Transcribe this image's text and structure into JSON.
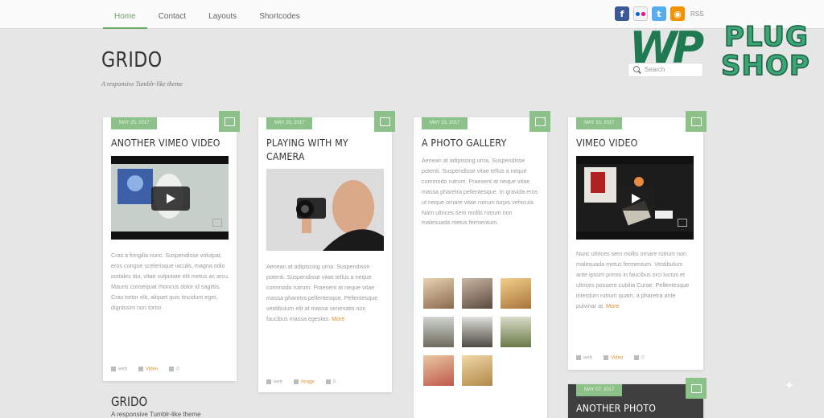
{
  "nav": {
    "items": [
      {
        "label": "Home",
        "active": true
      },
      {
        "label": "Contact",
        "active": false
      },
      {
        "label": "Layouts",
        "active": false
      },
      {
        "label": "Shortcodes",
        "active": false
      }
    ]
  },
  "social": {
    "rss_label": "RSS",
    "icons": [
      "facebook-icon",
      "flickr-icon",
      "twitter-icon",
      "rss-icon"
    ]
  },
  "site": {
    "title": "GRIDO",
    "tagline": "A responsive Tumblr-like theme"
  },
  "search": {
    "placeholder": "Search"
  },
  "watermark": {
    "wp": "WP",
    "plug": "PLUG",
    "shop": "SHOP"
  },
  "posts": [
    {
      "date": "MAY 25, 2017",
      "type_icon": "video-icon",
      "title": "ANOTHER VIMEO VIDEO",
      "excerpt": "Cras a fringilla nunc. Suspendisse volutpat, eros congue scelerisque iaculis, magna odio sodales dui, vitae vulputate elit metus ac arcu. Mauris consequat rhoncus dolor id sagittis. Cras tortor elit, aliquet quis tincidunt eget, dignissim non tortor.",
      "meta": {
        "author": "web",
        "tag": "Video",
        "comments": "0"
      }
    },
    {
      "date": "MAY 20, 2017",
      "type_icon": "image-icon",
      "title": "PLAYING WITH MY CAMERA",
      "excerpt": "Aenean at adipiscing urna. Suspendisse potenti. Suspendisse vitae tellus a neque commodo rutrum. Praesent at neque vitae massa pharetra pellentesque. Pellentesque vestibulum elit at massa venenatis non faucibus massa egestas.",
      "more": "More",
      "meta": {
        "author": "web",
        "tag": "Image",
        "comments": "0"
      }
    },
    {
      "date": "MAY 15, 2017",
      "type_icon": "gallery-icon",
      "title": "A PHOTO GALLERY",
      "excerpt": "Aenean at adipiscing urna. Suspendisse potenti. Suspendisse vitae tellus a neque commodo rutrum. Praesent at neque vitae massa pharetra pellentesque. In gravida eros ut neque ornare vitae rutrum turpis vehicula. Nam ultrices sem mollis rutrum non malesuada metus fermentum."
    },
    {
      "date": "MAY 10, 2017",
      "type_icon": "video-icon",
      "title": "VIMEO VIDEO",
      "excerpt": "Nunc ultrices sem mollis ornare rutrum non malesuada metus fermentum. Vestibulum ante ipsum primis in faucibus orci luctus et ultrices posuere cubilia Curae. Pellentesque interdum rutrum quam, a pharetra ante pulvinar at.",
      "more": "More",
      "meta": {
        "author": "web",
        "tag": "Video",
        "comments": "0"
      }
    },
    {
      "date": "MAY 07, 2017",
      "type_icon": "image-icon",
      "title": "ANOTHER PHOTO"
    }
  ],
  "footer": {
    "title": "GRIDO",
    "tagline": "A responsive Tumblr-like theme"
  },
  "colors": {
    "accent": "#8cc28a",
    "nav_active": "#6aa866",
    "link_orange": "#d9932c",
    "background": "#e6e6e6"
  }
}
